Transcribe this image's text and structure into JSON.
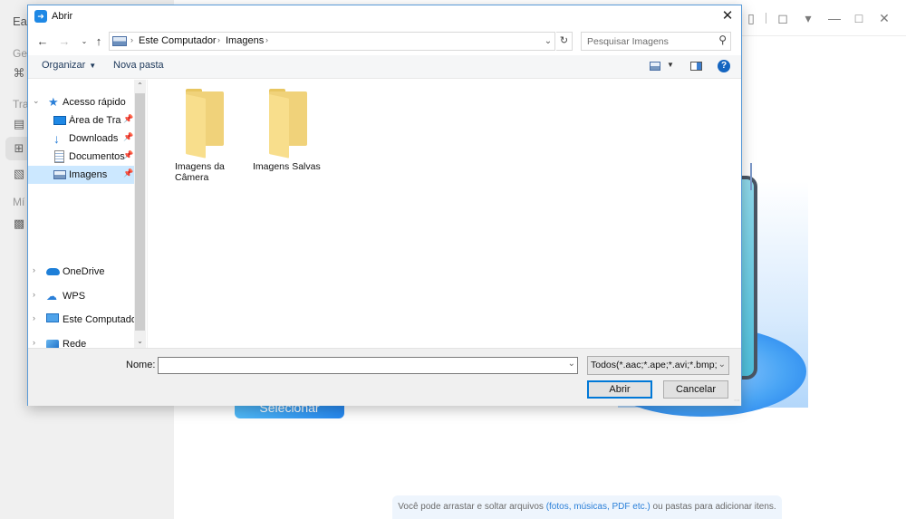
{
  "app": {
    "title_partial": "Eas",
    "sections": [
      "Ger",
      "Tra",
      "Mí"
    ],
    "select_files_button": "Selecionar Arquivos",
    "drop_hint": {
      "before": "Você pode arrastar e soltar arquivos ",
      "highlight": "(fotos, músicas, PDF etc.)",
      "after": " ou pastas para adicionar itens."
    },
    "window_controls": [
      "device-icon",
      "tshirt-icon",
      "dropdown-icon",
      "minimize-icon",
      "maximize-icon",
      "close-icon"
    ]
  },
  "dialog": {
    "title": "Abrir",
    "address": {
      "crumbs": [
        "Este Computador",
        "Imagens"
      ]
    },
    "search": {
      "placeholder": "Pesquisar Imagens",
      "value": ""
    },
    "commands": {
      "organize": "Organizar",
      "new_folder": "Nova pasta"
    },
    "nav_tree": [
      {
        "label": "Acesso rápido",
        "icon": "star-icon",
        "expanded": true,
        "level": 0
      },
      {
        "label": "Área de Traba",
        "icon": "desktop-icon",
        "pinned": true,
        "level": 1
      },
      {
        "label": "Downloads",
        "icon": "download-icon",
        "pinned": true,
        "level": 1
      },
      {
        "label": "Documentos",
        "icon": "document-icon",
        "pinned": true,
        "level": 1
      },
      {
        "label": "Imagens",
        "icon": "pictures-icon",
        "pinned": true,
        "level": 1,
        "selected": true
      },
      {
        "label": "OneDrive",
        "icon": "cloud-icon",
        "expanded": false,
        "level": 0
      },
      {
        "label": "WPS",
        "icon": "wps-cloud-icon",
        "expanded": false,
        "level": 0
      },
      {
        "label": "Este Computador",
        "icon": "computer-icon",
        "expanded": false,
        "level": 0
      },
      {
        "label": "Rede",
        "icon": "network-icon",
        "expanded": false,
        "level": 0
      }
    ],
    "folders": [
      {
        "line1": "Imagens da",
        "line2": "Câmera"
      },
      {
        "line1": "Imagens Salvas",
        "line2": ""
      }
    ],
    "filename": {
      "label": "Nome:",
      "value": ""
    },
    "file_type": "Todos(*.aac;*.ape;*.avi;*.bmp;*.",
    "buttons": {
      "open": "Abrir",
      "cancel": "Cancelar"
    }
  }
}
